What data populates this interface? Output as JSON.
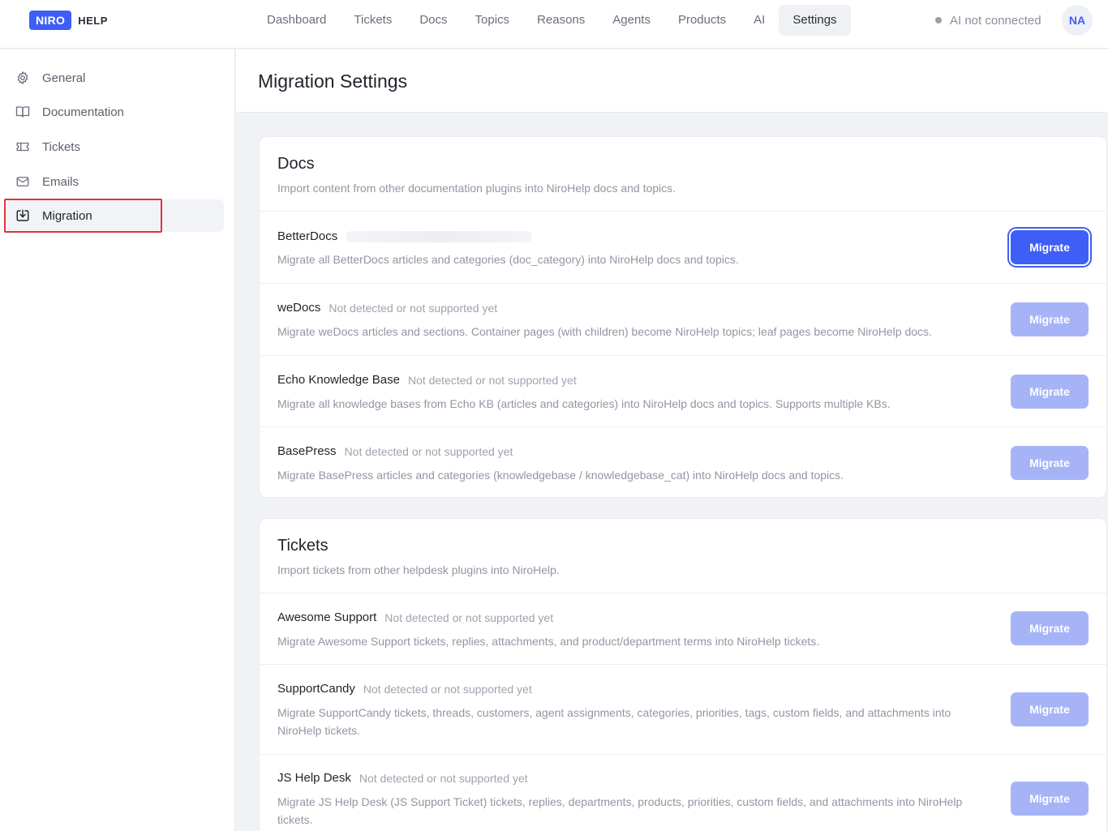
{
  "logo": {
    "badge": "NIRO",
    "text": "HELP"
  },
  "nav": [
    {
      "label": "Dashboard"
    },
    {
      "label": "Tickets"
    },
    {
      "label": "Docs"
    },
    {
      "label": "Topics"
    },
    {
      "label": "Reasons"
    },
    {
      "label": "Agents"
    },
    {
      "label": "Products"
    },
    {
      "label": "AI"
    },
    {
      "label": "Settings",
      "active": true
    }
  ],
  "ai_status": "AI not connected",
  "avatar": "NA",
  "sidebar": {
    "items": [
      {
        "label": "General",
        "icon": "gear-icon"
      },
      {
        "label": "Documentation",
        "icon": "book-icon"
      },
      {
        "label": "Tickets",
        "icon": "ticket-icon"
      },
      {
        "label": "Emails",
        "icon": "mail-icon"
      },
      {
        "label": "Migration",
        "icon": "import-icon",
        "active": true
      }
    ]
  },
  "page_title": "Migration Settings",
  "docs_section": {
    "title": "Docs",
    "subtitle": "Import content from other documentation plugins into NiroHelp docs and topics.",
    "rows": [
      {
        "name": "BetterDocs",
        "status": "",
        "description": "Migrate all BetterDocs articles and categories (doc_category) into NiroHelp docs and topics.",
        "button": "Migrate",
        "enabled": true
      },
      {
        "name": "weDocs",
        "status": "Not detected or not supported yet",
        "description": "Migrate weDocs articles and sections. Container pages (with children) become NiroHelp topics; leaf pages become NiroHelp docs.",
        "button": "Migrate",
        "enabled": false
      },
      {
        "name": "Echo Knowledge Base",
        "status": "Not detected or not supported yet",
        "description": "Migrate all knowledge bases from Echo KB (articles and categories) into NiroHelp docs and topics. Supports multiple KBs.",
        "button": "Migrate",
        "enabled": false
      },
      {
        "name": "BasePress",
        "status": "Not detected or not supported yet",
        "description": "Migrate BasePress articles and categories (knowledgebase / knowledgebase_cat) into NiroHelp docs and topics.",
        "button": "Migrate",
        "enabled": false
      }
    ]
  },
  "tickets_section": {
    "title": "Tickets",
    "subtitle": "Import tickets from other helpdesk plugins into NiroHelp.",
    "rows": [
      {
        "name": "Awesome Support",
        "status": "Not detected or not supported yet",
        "description": "Migrate Awesome Support tickets, replies, attachments, and product/department terms into NiroHelp tickets.",
        "button": "Migrate",
        "enabled": false
      },
      {
        "name": "SupportCandy",
        "status": "Not detected or not supported yet",
        "description": "Migrate SupportCandy tickets, threads, customers, agent assignments, categories, priorities, tags, custom fields, and attachments into NiroHelp tickets.",
        "button": "Migrate",
        "enabled": false
      },
      {
        "name": "JS Help Desk",
        "status": "Not detected or not supported yet",
        "description": "Migrate JS Help Desk (JS Support Ticket) tickets, replies, departments, products, priorities, custom fields, and attachments into NiroHelp tickets.",
        "button": "Migrate",
        "enabled": false
      }
    ]
  }
}
